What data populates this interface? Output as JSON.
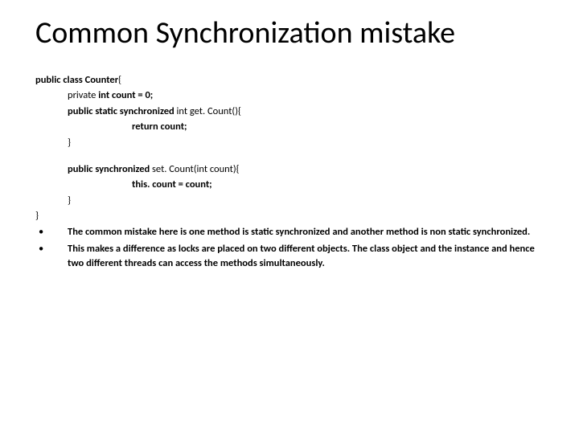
{
  "title": "Common Synchronization mistake",
  "code": {
    "l1a": "public class Counter",
    "l1b": "{",
    "l2a": "private ",
    "l2b": "int count = 0;",
    "l3a": "public static synchronized ",
    "l3b": "int get. Count(){",
    "l4": "return count;",
    "l5": "}",
    "l6a": "public synchronized ",
    "l6b": "set. Count(int count){",
    "l7": "this. count = count;",
    "l8": "}",
    "l9": "}"
  },
  "bullets": {
    "b1": "The common mistake here is one method is static synchronized and another method is non static synchronized.",
    "b2": "This makes a difference as locks are placed on two different objects. The class object and the instance and hence two different threads can access the methods simultaneously."
  },
  "glyphs": {
    "dot": "•"
  }
}
